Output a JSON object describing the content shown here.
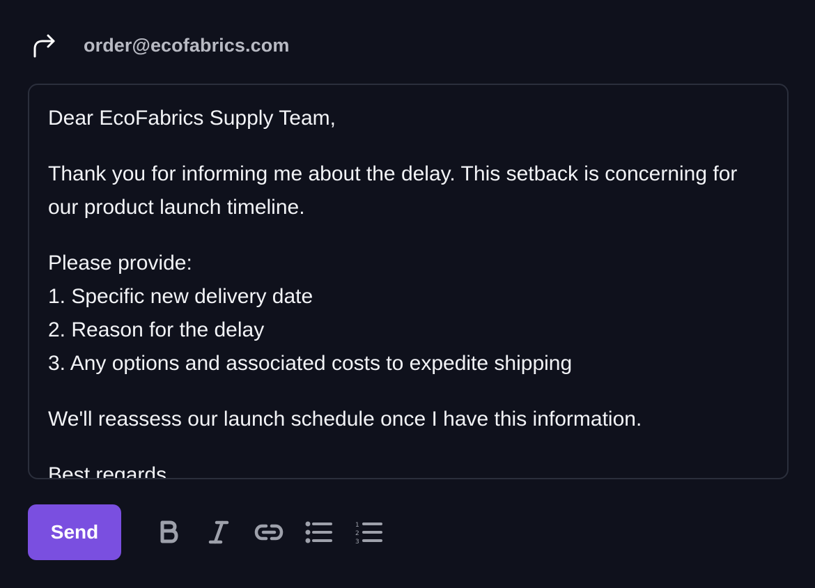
{
  "header": {
    "icon": "forward-arrow-icon",
    "recipient": "order@ecofabrics.com"
  },
  "editor": {
    "greeting": "Dear EcoFabrics Supply Team,",
    "paragraph1": "Thank you for informing me about the delay. This setback is concerning for our product launch timeline.",
    "request_intro": "Please provide:",
    "request_items": [
      "1. Specific new delivery date",
      "2. Reason for the delay",
      "3. Any options and associated costs to expedite shipping"
    ],
    "paragraph3": "We'll reassess our launch schedule once I have this information.",
    "closing": "Best regards,"
  },
  "footer": {
    "send_label": "Send",
    "send_color": "#7a4fe0",
    "tools": [
      "bold-icon",
      "italic-icon",
      "link-icon",
      "bulleted-list-icon",
      "numbered-list-icon"
    ]
  },
  "colors": {
    "background": "#0f111c",
    "border": "#2b2f3c",
    "text": "#f2f3f6",
    "muted_text": "#b8bac3",
    "icon": "#9ea1ab"
  }
}
